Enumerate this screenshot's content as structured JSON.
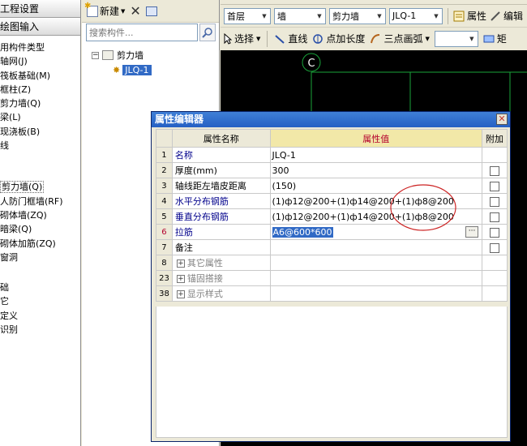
{
  "left_panel": {
    "section1": "工程设置",
    "section2": "绘图输入",
    "items": [
      "用构件类型",
      "轴网(J)",
      "筏板基础(M)",
      "框柱(Z)",
      "剪力墙(Q)",
      "梁(L)",
      "现浇板(B)",
      "线"
    ],
    "items2": [
      "剪力墙(Q)",
      "人防门框墙(RF)",
      "砌体墙(ZQ)",
      "暗梁(Q)",
      "砌体加筋(ZQ)",
      "窗洞"
    ],
    "items3": [
      "础",
      "它",
      "定义",
      "识别"
    ]
  },
  "component_panel": {
    "new_label": "新建",
    "search_placeholder": "搜索构件...",
    "tree_root": "剪力墙",
    "tree_child": "JLQ-1"
  },
  "toolbar": {
    "floor": "首层",
    "type": "墙",
    "category": "剪力墙",
    "component": "JLQ-1",
    "property_label": "属性",
    "edit_label": "编辑",
    "select_label": "选择",
    "line_label": "直线",
    "point_len_label": "点加长度",
    "arc_label": "三点画弧",
    "rect_label": "矩"
  },
  "canvas": {
    "axis_label": "C",
    "line_color": "#1aa33a",
    "circle_color": "#ffffff"
  },
  "dialog": {
    "title": "属性编辑器",
    "headers": {
      "num": "",
      "name": "属性名称",
      "value": "属性值",
      "add": "附加"
    },
    "rows": [
      {
        "num": "1",
        "name": "名称",
        "value": "JLQ-1",
        "has_check": false,
        "style": "blue"
      },
      {
        "num": "2",
        "name": "厚度(mm)",
        "value": "300",
        "has_check": true,
        "style": "normal"
      },
      {
        "num": "3",
        "name": "轴线距左墙皮距离",
        "value": "(150)",
        "has_check": true,
        "style": "normal"
      },
      {
        "num": "4",
        "name": "水平分布钢筋",
        "value": "(1)ф12@200+(1)ф14@200+(1)ф8@200",
        "has_check": true,
        "style": "blue"
      },
      {
        "num": "5",
        "name": "垂直分布钢筋",
        "value": "(1)ф12@200+(1)ф14@200+(1)ф8@200",
        "has_check": true,
        "style": "blue"
      },
      {
        "num": "6",
        "name": "拉筋",
        "value": "A6@600*600",
        "has_check": true,
        "style": "selected"
      },
      {
        "num": "7",
        "name": "备注",
        "value": "",
        "has_check": true,
        "style": "normal"
      },
      {
        "num": "8",
        "name": "其它属性",
        "value": "",
        "has_check": false,
        "style": "group"
      },
      {
        "num": "23",
        "name": "锚固搭接",
        "value": "",
        "has_check": false,
        "style": "group"
      },
      {
        "num": "38",
        "name": "显示样式",
        "value": "",
        "has_check": false,
        "style": "group"
      }
    ],
    "annotation_color": "#cc2222"
  }
}
